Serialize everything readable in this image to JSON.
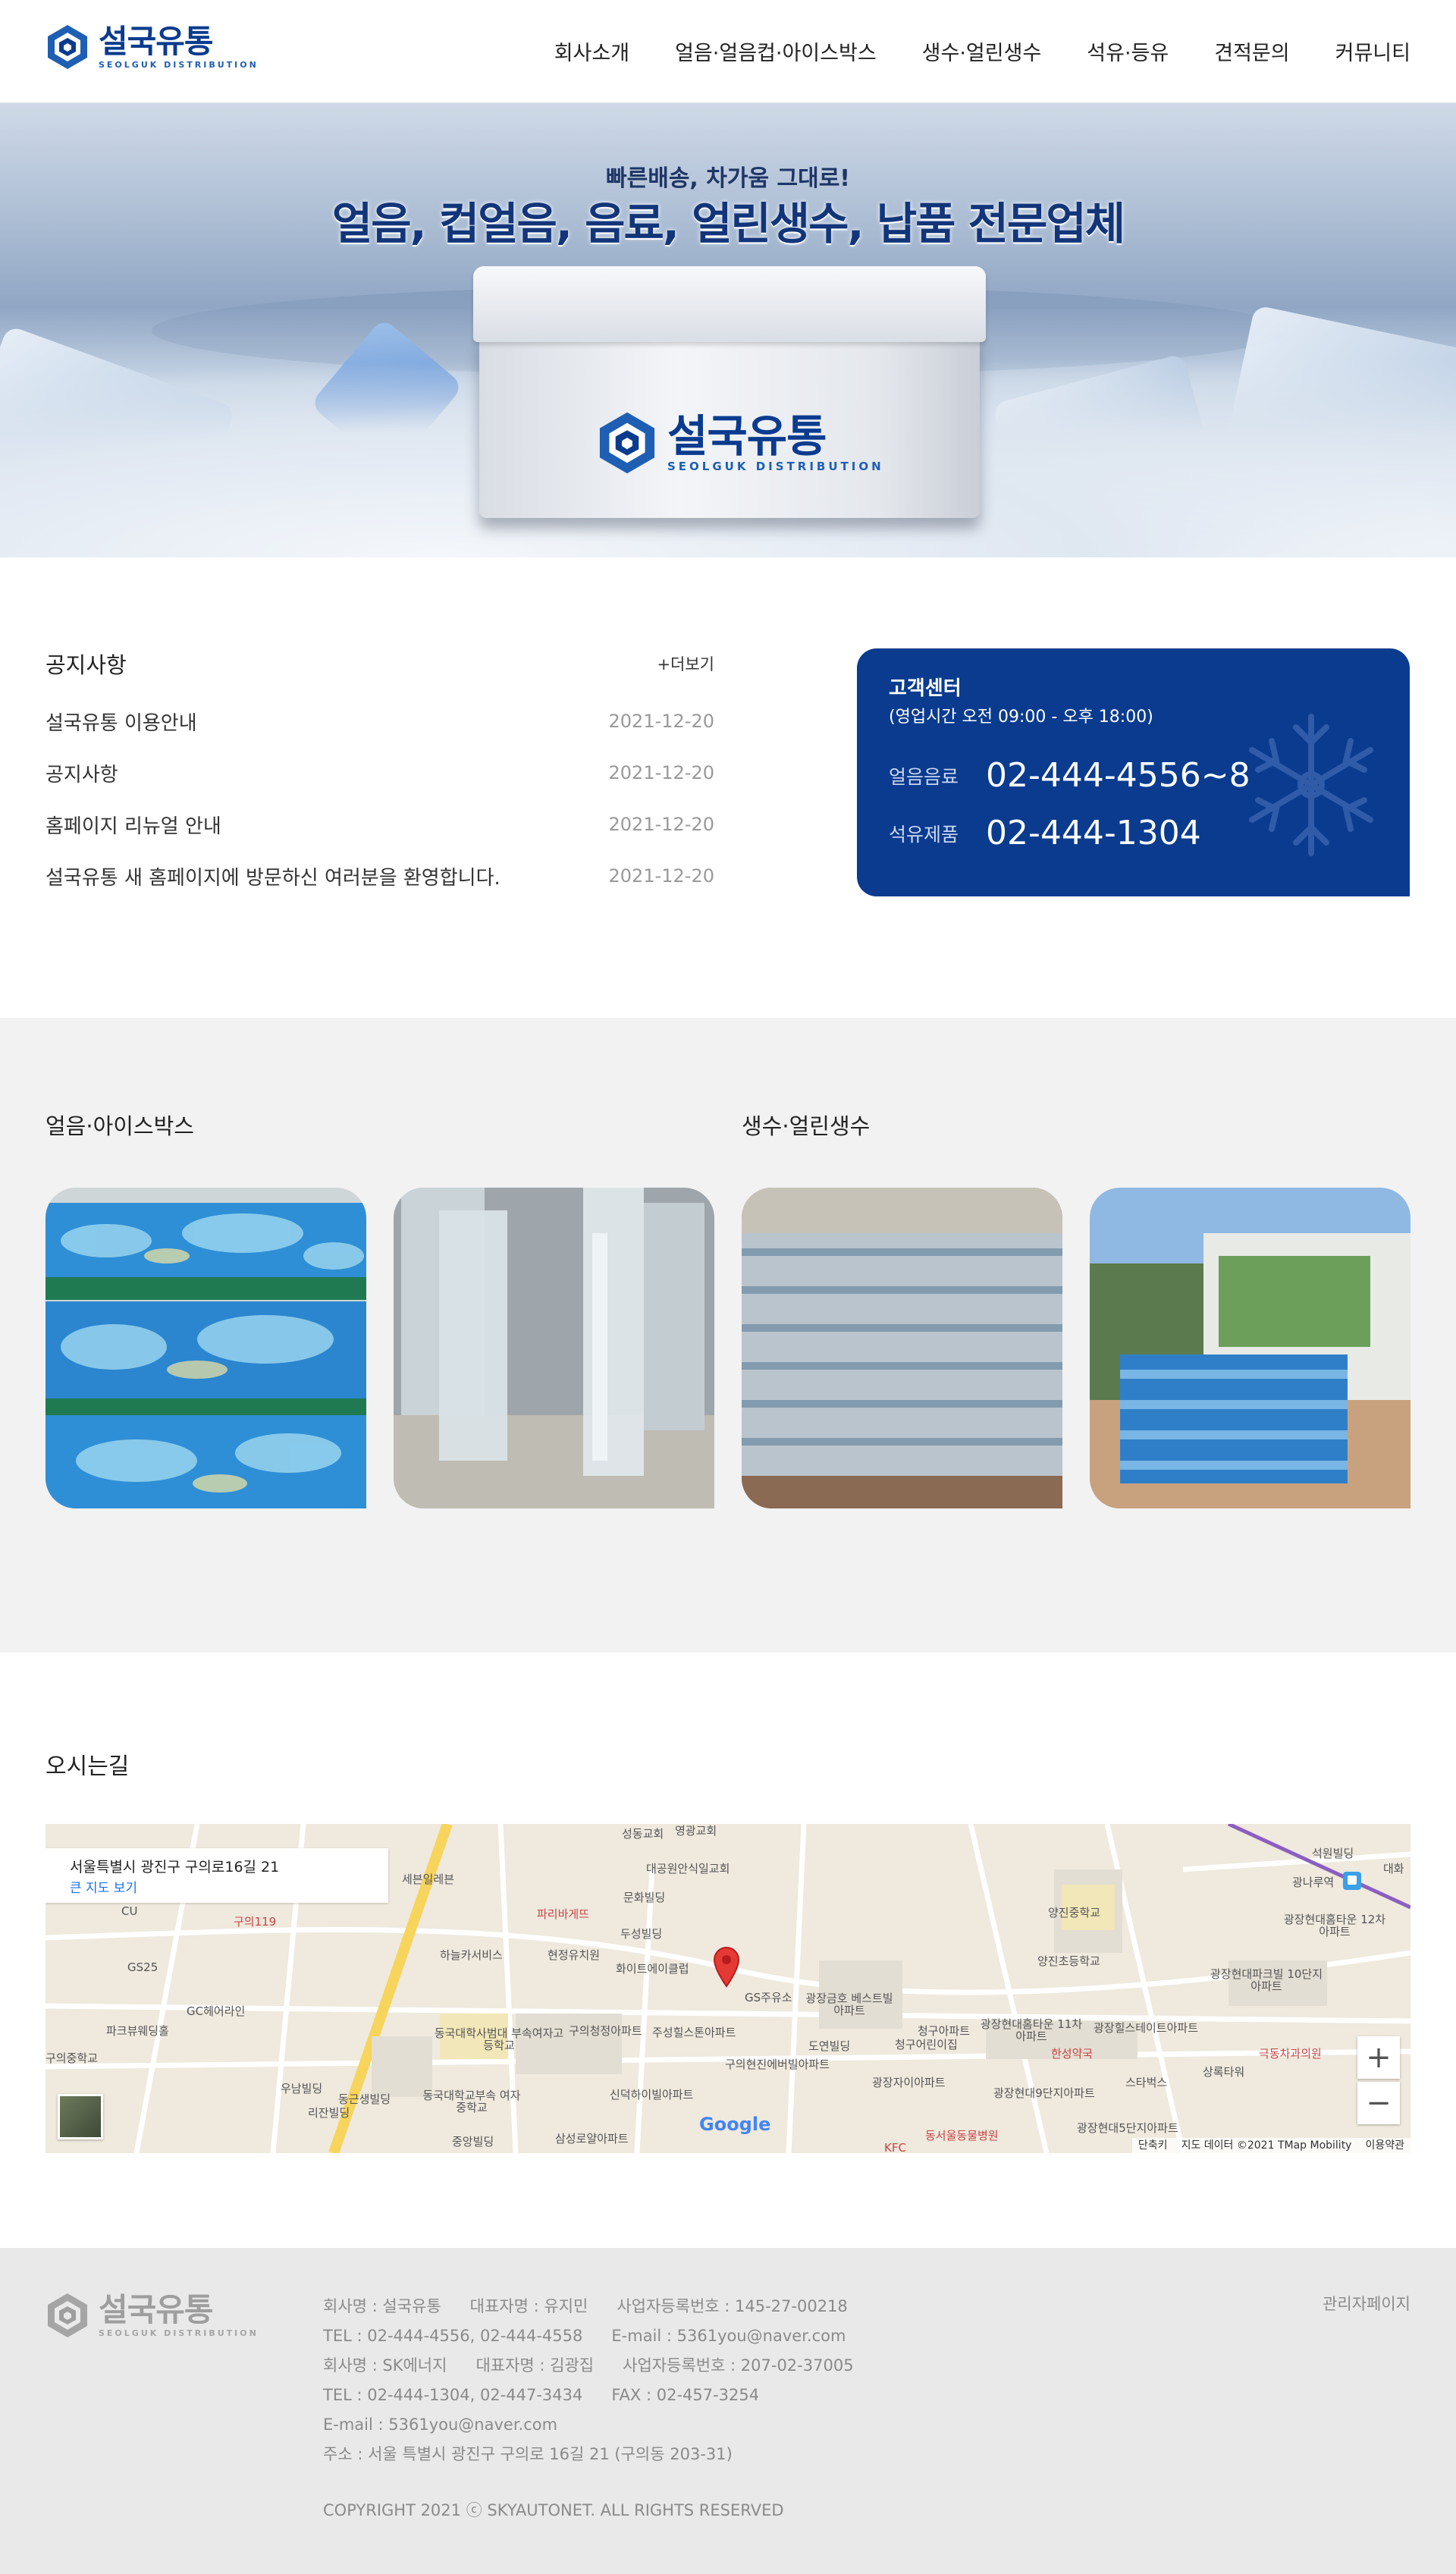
{
  "header": {
    "logo": {
      "kr": "설국유통",
      "en": "SEOLGUK DISTRIBUTION"
    },
    "nav": [
      "회사소개",
      "얼음·얼음컵·아이스박스",
      "생수·얼린생수",
      "석유·등유",
      "견적문의",
      "커뮤니티"
    ]
  },
  "hero": {
    "subtitle": "빠른배송, 차가움 그대로!",
    "title": "얼음, 컵얼음, 음료, 얼린생수, 납품 전문업체",
    "box_logo_kr": "설국유통",
    "box_logo_en": "SEOLGUK DISTRIBUTION"
  },
  "notice": {
    "title": "공지사항",
    "more": "+더보기",
    "items": [
      {
        "title": "설국유통 이용안내",
        "date": "2021-12-20"
      },
      {
        "title": "공지사항",
        "date": "2021-12-20"
      },
      {
        "title": "홈페이지 리뉴얼 안내",
        "date": "2021-12-20"
      },
      {
        "title": "설국유통 새 홈페이지에 방문하신 여러분을 환영합니다.",
        "date": "2021-12-20"
      }
    ]
  },
  "customer_center": {
    "title": "고객센터",
    "hours": "(영업시간  오전 09:00 - 오후 18:00)",
    "lines": [
      {
        "label": "얼음음료",
        "number": "02-444-4556~8"
      },
      {
        "label": "석유제품",
        "number": "02-444-1304"
      }
    ]
  },
  "products": {
    "left_title": "얼음·아이스박스",
    "right_title": "생수·얼린생수"
  },
  "location": {
    "title": "오시는길",
    "address": "서울특별시 광진구 구의로16길 21",
    "large_map": "큰 지도 보기",
    "google": "Google",
    "attribution": [
      "단축키",
      "지도 데이터 ©2021 TMap Mobility",
      "이용약관"
    ],
    "labels": [
      "성동교회",
      "영광교회",
      "대공원안식일교회",
      "세븐일레븐",
      "문화빌딩",
      "구의119",
      "파리바게뜨",
      "두성빌딩",
      "CU",
      "GS25",
      "하늘카서비스",
      "현정유치원",
      "화이트에이클럽",
      "GS주유소",
      "광장금호 베스트빌아파트",
      "양진중학교",
      "양진초등학교",
      "광장현대홈타운 12차아파트",
      "광장현대파크빌 10단지아파트",
      "광장힐스테이트아파트",
      "광장현대홈타운 11차아파트",
      "청구아파트",
      "청구어린이집",
      "도연빌딩",
      "구의현진에버빌아파트",
      "구의청정아파트",
      "주성힐스톤아파트",
      "동국대학사범대 부속여자고등학교",
      "GC헤어라인",
      "파크뷰웨딩홀",
      "구의중학교",
      "우남빌딩",
      "동근생빌딩",
      "리잔빌딩",
      "동국대학교부속 여자중학교",
      "신덕하이빌아파트",
      "중앙빌딩",
      "삼성로얄아파트",
      "광장자이아파트",
      "광장현대9단지아파트",
      "한성약국",
      "스타벅스",
      "상록타워",
      "극동차과의원",
      "광장현대5단지아파트",
      "동서울동물병원",
      "KFC",
      "석원빌딩",
      "광나루역",
      "대화"
    ]
  },
  "footer": {
    "logo": {
      "kr": "설국유통",
      "en": "SEOLGUK DISTRIBUTION"
    },
    "lines": [
      [
        "회사명 : 설국유통",
        "대표자명 : 유지민",
        "사업자등록번호 : 145-27-00218"
      ],
      [
        "TEL : 02-444-4556, 02-444-4558",
        "E-mail : 5361you@naver.com"
      ],
      [
        "회사명 : SK에너지",
        "대표자명 : 김광집",
        "사업자등록번호 : 207-02-37005"
      ],
      [
        "TEL : 02-444-1304, 02-447-3434",
        "FAX : 02-457-3254"
      ],
      [
        "E-mail : 5361you@naver.com"
      ],
      [
        "주소 : 서울 특별시 광진구 구의로 16길 21 (구의동 203-31)"
      ]
    ],
    "copyright": "COPYRIGHT 2021 ⓒ SKYAUTONET. ALL RIGHTS RESERVED",
    "admin": "관리자페이지"
  },
  "colors": {
    "brand": "#0a3b8f",
    "logo_light": "#1e5fb4",
    "footer_bg": "#e9e9e9",
    "products_bg": "#f2f2f2"
  }
}
